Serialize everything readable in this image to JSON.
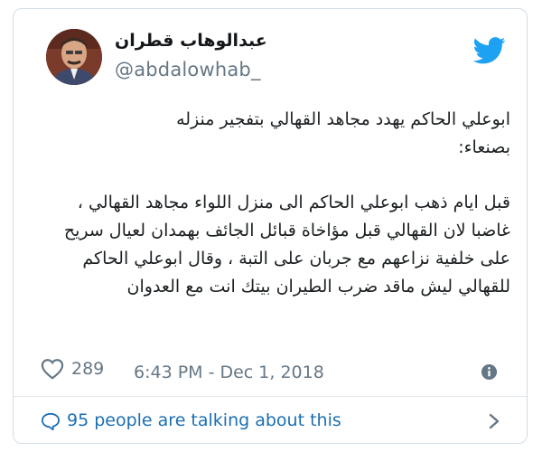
{
  "author": {
    "display_name": "عبدالوهاب قطران",
    "handle": "@abdalowhab_"
  },
  "tweet": {
    "line1": "ابوعلي الحاكم يهدد مجاهد القهالي بتفجير منزله",
    "line2": "بصنعاء:",
    "para2": "قبل ايام ذهب ابوعلي الحاكم الى منزل اللواء مجاهد القهالي ، غاضبا لان القهالي قبل مؤاخاة قبائل الجائف بهمدان لعيال سريح على خلفية نزاعهم مع جربان على التبة ، وقال ابوعلي الحاكم للقهالي ليش ماقد ضرب الطيران بيتك انت مع العدوان"
  },
  "footer": {
    "like_count": "289",
    "timestamp": "6:43 PM - Dec 1, 2018"
  },
  "conversation": {
    "label": "95 people are talking about this"
  },
  "colors": {
    "twitter_blue": "#1da1f2",
    "link_blue": "#1b6fb4",
    "muted": "#657786"
  },
  "icons": [
    "twitter-logo-icon",
    "heart-icon",
    "info-icon",
    "speech-bubble-icon",
    "chevron-right-icon"
  ]
}
